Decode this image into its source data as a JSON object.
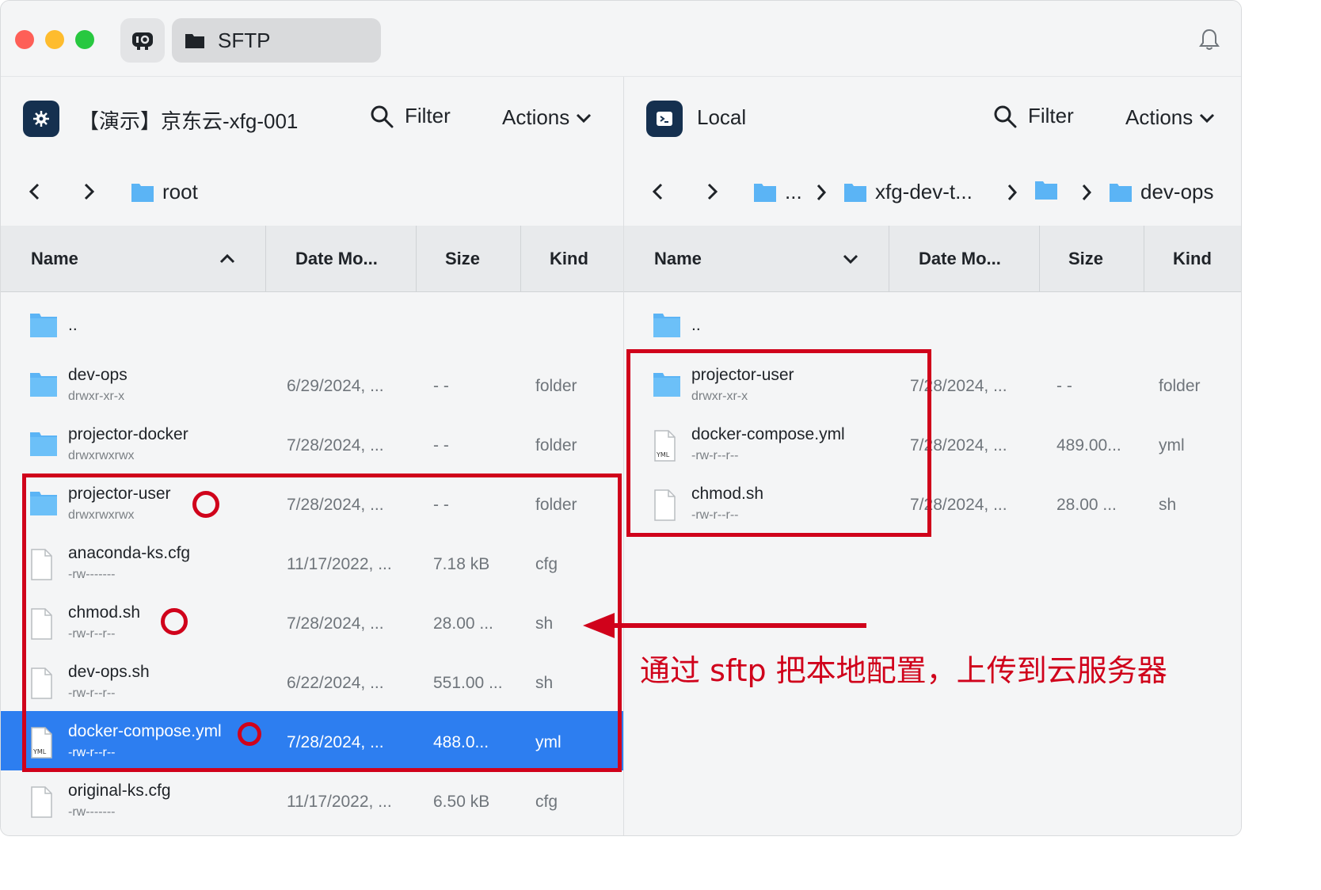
{
  "titlebar": {
    "tab_label": "SFTP"
  },
  "left_panel": {
    "host_name": "【演示】京东云-xfg-001",
    "filter_label": "Filter",
    "actions_label": "Actions",
    "breadcrumb": [
      "root"
    ],
    "columns": [
      "Name",
      "Date Mo...",
      "Size",
      "Kind"
    ],
    "rows": [
      {
        "name": "..",
        "perm": "",
        "date": "",
        "size": "",
        "kind": "",
        "type": "folder"
      },
      {
        "name": "dev-ops",
        "perm": "drwxr-xr-x",
        "date": "6/29/2024, ...",
        "size": "- -",
        "kind": "folder",
        "type": "folder"
      },
      {
        "name": "projector-docker",
        "perm": "drwxrwxrwx",
        "date": "7/28/2024, ...",
        "size": "- -",
        "kind": "folder",
        "type": "folder"
      },
      {
        "name": "projector-user",
        "perm": "drwxrwxrwx",
        "date": "7/28/2024, ...",
        "size": "- -",
        "kind": "folder",
        "type": "folder"
      },
      {
        "name": "anaconda-ks.cfg",
        "perm": "-rw-------",
        "date": "11/17/2022, ...",
        "size": "7.18 kB",
        "kind": "cfg",
        "type": "file"
      },
      {
        "name": "chmod.sh",
        "perm": "-rw-r--r--",
        "date": "7/28/2024, ...",
        "size": "28.00 ...",
        "kind": "sh",
        "type": "file"
      },
      {
        "name": "dev-ops.sh",
        "perm": "-rw-r--r--",
        "date": "6/22/2024, ...",
        "size": "551.00 ...",
        "kind": "sh",
        "type": "file"
      },
      {
        "name": "docker-compose.yml",
        "perm": "-rw-r--r--",
        "date": "7/28/2024, ...",
        "size": "488.0...",
        "kind": "yml",
        "type": "yml",
        "selected": true
      },
      {
        "name": "original-ks.cfg",
        "perm": "-rw-------",
        "date": "11/17/2022, ...",
        "size": "6.50 kB",
        "kind": "cfg",
        "type": "file"
      }
    ]
  },
  "right_panel": {
    "host_name": "Local",
    "filter_label": "Filter",
    "actions_label": "Actions",
    "breadcrumb": [
      "...",
      "xfg-dev-t...",
      "",
      "dev-ops"
    ],
    "columns": [
      "Name",
      "Date Mo...",
      "Size",
      "Kind"
    ],
    "rows": [
      {
        "name": "..",
        "perm": "",
        "date": "",
        "size": "",
        "kind": "",
        "type": "folder"
      },
      {
        "name": "projector-user",
        "perm": "drwxr-xr-x",
        "date": "7/28/2024, ...",
        "size": "- -",
        "kind": "folder",
        "type": "folder"
      },
      {
        "name": "docker-compose.yml",
        "perm": "-rw-r--r--",
        "date": "7/28/2024, ...",
        "size": "489.00...",
        "kind": "yml",
        "type": "yml"
      },
      {
        "name": "chmod.sh",
        "perm": "-rw-r--r--",
        "date": "7/28/2024, ...",
        "size": "28.00 ...",
        "kind": "sh",
        "type": "file"
      }
    ]
  },
  "annotation": {
    "text": "通过 sftp 把本地配置，上传到云服务器",
    "color": "#d0021b"
  },
  "colors": {
    "selected_row": "#2d7ef0",
    "folder": "#5bb4f5",
    "host_icon_bg": "#15304f"
  }
}
